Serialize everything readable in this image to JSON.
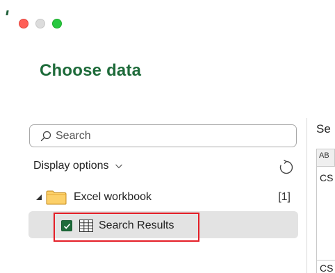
{
  "window": {
    "controls": [
      "close",
      "minimize",
      "maximize"
    ]
  },
  "page": {
    "title": "Choose data"
  },
  "search": {
    "placeholder": "Search",
    "value": ""
  },
  "display_options": {
    "label": "Display options"
  },
  "tree": {
    "workbook": {
      "label": "Excel workbook",
      "count": "[1]",
      "expanded": true
    },
    "results": {
      "label": "Search Results",
      "checked": true
    }
  },
  "preview": {
    "title": "Se",
    "column_header_icon": "AB",
    "cells": [
      "CS",
      "CS"
    ]
  },
  "colors": {
    "accent": "#1e6b3a",
    "highlight": "#e41e26",
    "selected_row": "#e3e3e3"
  },
  "icons": {
    "search": "search-icon",
    "refresh": "refresh-icon",
    "folder": "folder-icon",
    "table": "table-icon",
    "chevron": "chevron-down-icon"
  }
}
